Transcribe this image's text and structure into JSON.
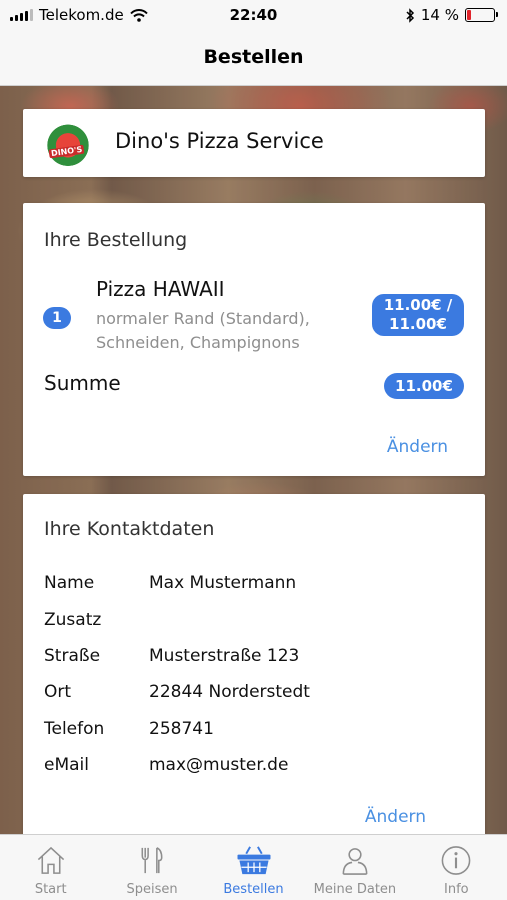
{
  "status_bar": {
    "carrier": "Telekom.de",
    "time": "22:40",
    "battery_percent": "14 %",
    "battery_level": 0.14,
    "icons": [
      "signal-icon",
      "wifi-icon",
      "bluetooth-icon",
      "battery-icon"
    ]
  },
  "nav": {
    "title": "Bestellen"
  },
  "shop": {
    "name": "Dino's Pizza Service",
    "logo_text": "DINO'S"
  },
  "order": {
    "heading": "Ihre Bestellung",
    "items": [
      {
        "quantity": "1",
        "name": "Pizza HAWAII",
        "description": "normaler Rand (Standard), Schneiden, Champignons",
        "price_line1": "11.00€ /",
        "price_line2": "11.00€"
      }
    ],
    "sum_label": "Summe",
    "sum_value": "11.00€",
    "edit_label": "Ändern"
  },
  "contact": {
    "heading": "Ihre Kontaktdaten",
    "rows": [
      {
        "label": "Name",
        "value": "Max Mustermann"
      },
      {
        "label": "Zusatz",
        "value": ""
      },
      {
        "label": "Straße",
        "value": "Musterstraße 123"
      },
      {
        "label": "Ort",
        "value": "22844 Norderstedt"
      },
      {
        "label": "Telefon",
        "value": "258741"
      },
      {
        "label": "eMail",
        "value": "max@muster.de"
      }
    ],
    "edit_label": "Ändern"
  },
  "tabs": [
    {
      "label": "Start",
      "icon": "home-icon",
      "active": false
    },
    {
      "label": "Speisen",
      "icon": "cutlery-icon",
      "active": false
    },
    {
      "label": "Bestellen",
      "icon": "basket-icon",
      "active": true
    },
    {
      "label": "Meine Daten",
      "icon": "user-icon",
      "active": false
    },
    {
      "label": "Info",
      "icon": "info-icon",
      "active": false
    }
  ],
  "colors": {
    "accent": "#3b7ae0",
    "link": "#4a90e2",
    "battery_low": "#e0242b"
  }
}
